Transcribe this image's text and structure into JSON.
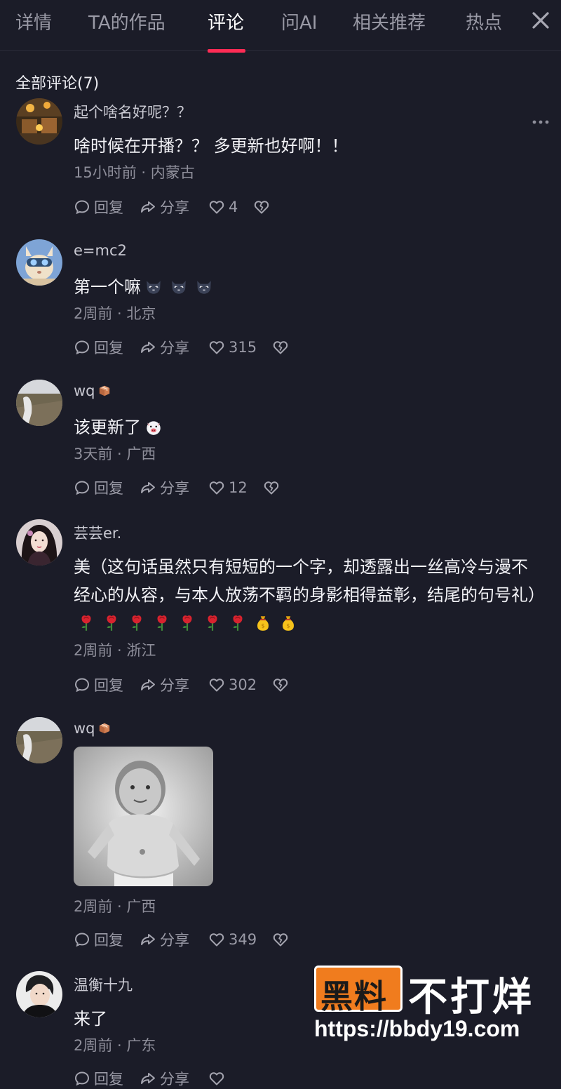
{
  "tabs": [
    {
      "label": "详情"
    },
    {
      "label": "TA的作品"
    },
    {
      "label": "评论"
    },
    {
      "label": "问AI"
    },
    {
      "label": "相关推荐"
    },
    {
      "label": "热点"
    }
  ],
  "active_tab": "评论",
  "accent_color": "#fe2c55",
  "comments_header": "全部评论(7)",
  "actions": {
    "reply": "回复",
    "share": "分享"
  },
  "comments": [
    {
      "user": "起个啥名好呢？？",
      "text": "啥时候在开播？？ 多更新也好啊！！",
      "meta": "15小时前 · 内蒙古",
      "likes": "4"
    },
    {
      "user": "e=mc2",
      "text": "第一个嘛",
      "meta": "2周前 · 北京",
      "likes": "315"
    },
    {
      "user": "wq",
      "text": "该更新了",
      "meta": "3天前 · 广西",
      "likes": "12"
    },
    {
      "user": "芸芸er.",
      "text": "美（这句话虽然只有短短的一个字，却透露出一丝高冷与漫不经心的从容，与本人放荡不羁的身影相得益彰，结尾的句号礼）",
      "meta": "2周前 · 浙江",
      "likes": "302"
    },
    {
      "user": "wq",
      "text": "",
      "meta": "2周前 · 广西",
      "likes": "349"
    },
    {
      "user": "温衡十九",
      "text": "来了",
      "meta": "2周前 · 广东",
      "likes": ""
    }
  ],
  "watermark": {
    "brand_box": "黑料",
    "brand_text": "不打烊",
    "url": "https://bbdy19.com"
  }
}
